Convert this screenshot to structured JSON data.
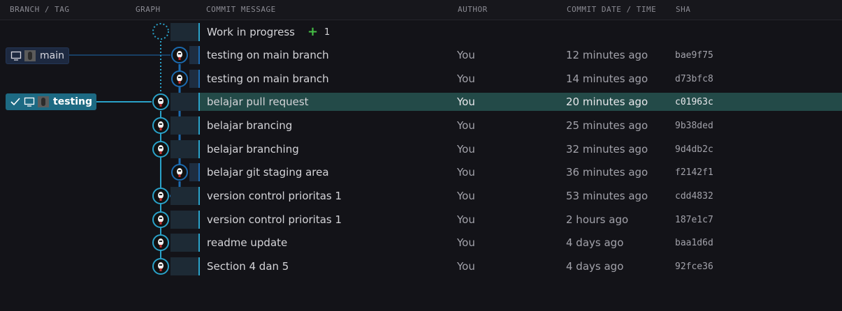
{
  "headers": {
    "branch": "BRANCH / TAG",
    "graph": "GRAPH",
    "message": "COMMIT MESSAGE",
    "author": "AUTHOR",
    "date": "COMMIT DATE / TIME",
    "sha": "SHA"
  },
  "wip": {
    "message": "Work in progress",
    "count": "1"
  },
  "branches": {
    "main": {
      "label": "main"
    },
    "testing": {
      "label": "testing"
    }
  },
  "colors": {
    "main_lane": "#1c6bb0",
    "testing_lane": "#2aa2c9",
    "selected_row": "#234a48"
  },
  "commits": [
    {
      "message": "testing on main branch",
      "author": "You",
      "date": "12 minutes ago",
      "sha": "bae9f75",
      "lane": "main"
    },
    {
      "message": "testing on main branch",
      "author": "You",
      "date": "14 minutes ago",
      "sha": "d73bfc8",
      "lane": "main"
    },
    {
      "message": "belajar pull request",
      "author": "You",
      "date": "20 minutes ago",
      "sha": "c01963c",
      "lane": "testing",
      "selected": true
    },
    {
      "message": "belajar brancing",
      "author": "You",
      "date": "25 minutes ago",
      "sha": "9b38ded",
      "lane": "testing"
    },
    {
      "message": "belajar branching",
      "author": "You",
      "date": "32 minutes ago",
      "sha": "9d4db2c",
      "lane": "testing"
    },
    {
      "message": "belajar git staging area",
      "author": "You",
      "date": "36 minutes ago",
      "sha": "f2142f1",
      "lane": "main"
    },
    {
      "message": "version control prioritas 1",
      "author": "You",
      "date": "53 minutes ago",
      "sha": "cdd4832",
      "lane": "testing"
    },
    {
      "message": "version control prioritas 1",
      "author": "You",
      "date": "2 hours ago",
      "sha": "187e1c7",
      "lane": "testing"
    },
    {
      "message": "readme update",
      "author": "You",
      "date": "4 days ago",
      "sha": "baa1d6d",
      "lane": "testing"
    },
    {
      "message": "Section 4 dan 5",
      "author": "You",
      "date": "4 days ago",
      "sha": "92fce36",
      "lane": "testing"
    }
  ]
}
